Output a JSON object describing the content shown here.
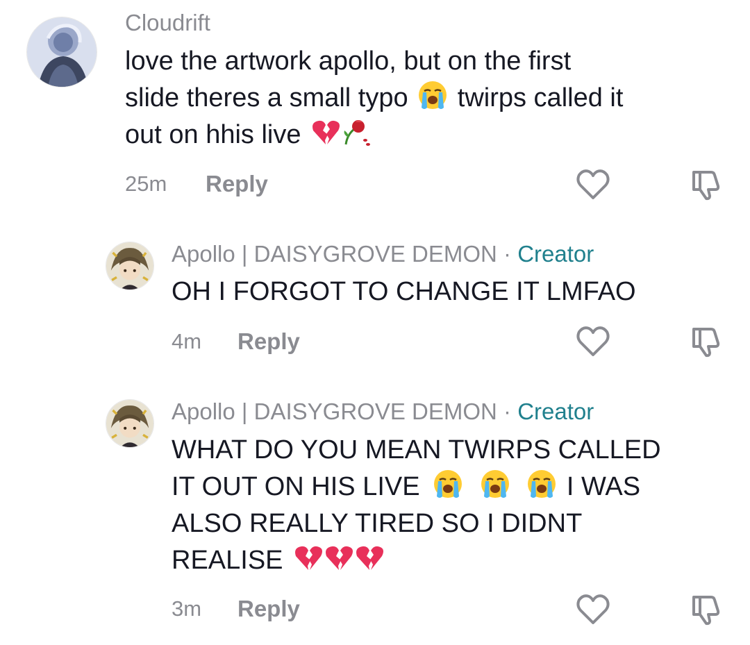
{
  "comments": [
    {
      "username": "Cloudrift",
      "text_lines": [
        "love the artwork apollo, but on the first",
        "slide theres a small typo",
        "twirps called it",
        "out on hhis live"
      ],
      "timestamp": "25m",
      "reply_label": "Reply"
    },
    {
      "username": "Apollo | DAISYGROVE DEMON",
      "separator": "·",
      "badge": "Creator",
      "text": "OH I FORGOT TO CHANGE IT LMFAO",
      "timestamp": "4m",
      "reply_label": "Reply"
    },
    {
      "username": "Apollo | DAISYGROVE DEMON",
      "separator": "·",
      "badge": "Creator",
      "text_lines": [
        "WHAT DO YOU MEAN TWIRPS CALLED",
        "IT OUT ON HIS LIVE",
        "I WAS",
        "ALSO REALLY TIRED SO I DIDNT",
        "REALISE"
      ],
      "timestamp": "3m",
      "reply_label": "Reply"
    }
  ],
  "icons": {
    "like": "heart-outline-icon",
    "dislike": "thumbs-down-outline-icon",
    "crying": "loudly-crying-face-emoji",
    "broken_heart": "broken-heart-emoji",
    "wilted_flower": "wilted-rose-emoji"
  },
  "colors": {
    "creator_badge": "#20808d",
    "secondary_text": "#8a8b91",
    "primary_text": "#161823"
  }
}
